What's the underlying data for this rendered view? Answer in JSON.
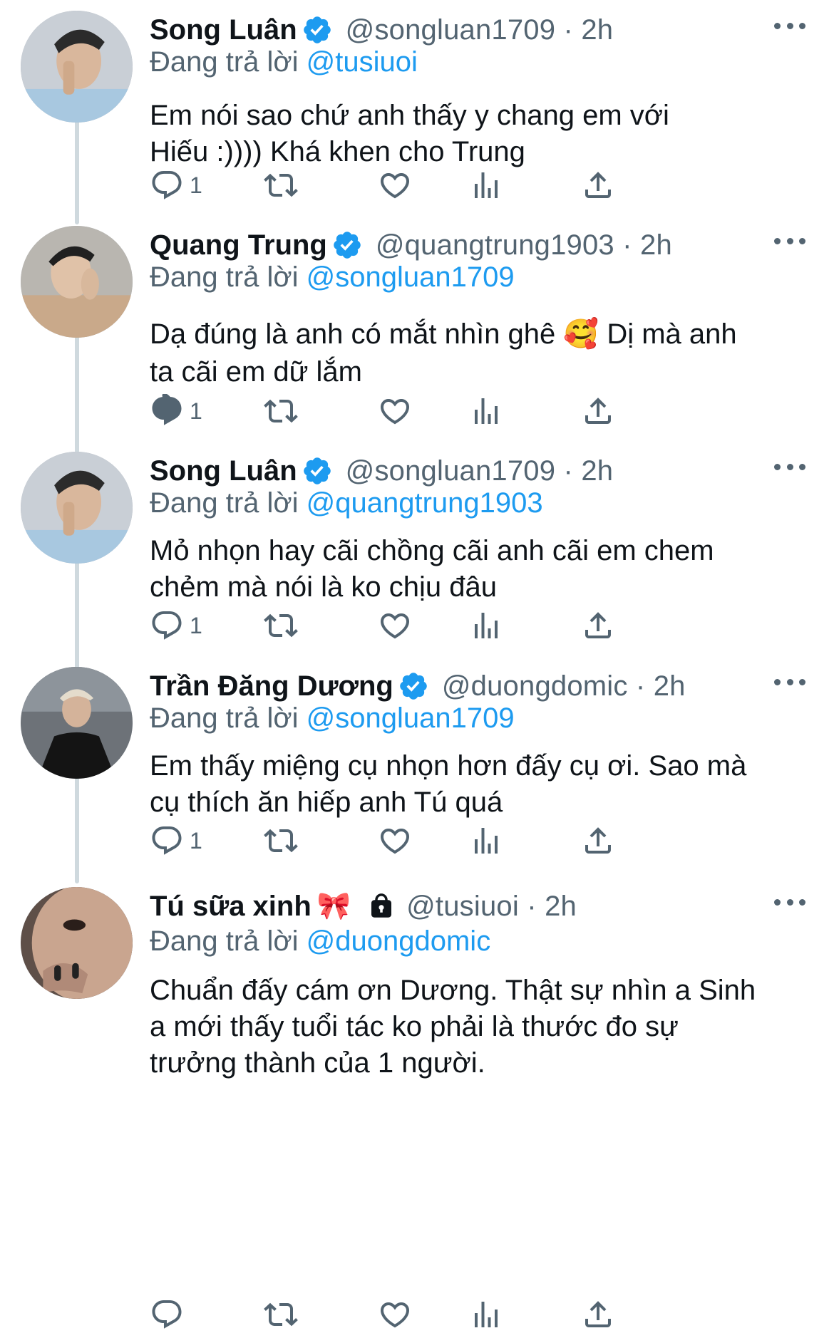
{
  "tweets": [
    {
      "name": "Song Luân",
      "verified": true,
      "handle": "@songluan1709",
      "time": "2h",
      "meta": "@songluan1709 · 2h",
      "reply_prefix": "Đang trả lời ",
      "reply_to": "@tusiuoi",
      "text": "Em nói sao chứ anh thấy y chang em với\nHiếu :)))) Khá khen cho Trung",
      "reply_count": "1"
    },
    {
      "name": "Quang Trung",
      "verified": true,
      "handle": "@quangtrung1903",
      "time": "2h",
      "meta": "@quangtrung1903 · 2h",
      "reply_prefix": "Đang trả lời ",
      "reply_to": "@songluan1709",
      "text": "Dạ đúng là anh có mắt nhìn ghê 🥰 Dị mà anh\nta cãi em dữ lắm",
      "reply_count": "1"
    },
    {
      "name": "Song Luân",
      "verified": true,
      "handle": "@songluan1709",
      "time": "2h",
      "meta": "@songluan1709 · 2h",
      "reply_prefix": "Đang trả lời ",
      "reply_to": "@quangtrung1903",
      "text": "Mỏ nhọn hay cãi chồng cãi anh cãi em chem\nchẻm mà nói là ko chịu đâu",
      "reply_count": "1"
    },
    {
      "name": "Trần Đăng Dương",
      "verified": true,
      "handle": "@duongdomic",
      "time": "2h",
      "meta": "@duongdomic · 2h",
      "reply_prefix": "Đang trả lời ",
      "reply_to": "@songluan1709",
      "text": "Em thấy miệng cụ nhọn hơn đấy cụ ơi. Sao mà\ncụ thích ăn hiếp anh Tú quá",
      "reply_count": "1"
    },
    {
      "name": "Tú sữa xinh",
      "name_emoji": "🎀",
      "verified": false,
      "protected": true,
      "handle": "@tusiuoi",
      "time": "2h",
      "meta": "@tusiuoi · 2h",
      "reply_prefix": "Đang trả lời ",
      "reply_to": "@duongdomic",
      "text": "Chuẩn đấy cám ơn Dương. Thật sự nhìn a Sinh\na mới thấy tuổi tác ko phải là thước đo sự\ntrưởng thành của 1 người.",
      "reply_count": ""
    }
  ],
  "icons": {
    "reply": "speech-bubble-icon",
    "retweet": "retweet-icon",
    "like": "heart-icon",
    "views": "bar-chart-icon",
    "share": "share-upload-icon",
    "more": "more-dots-icon",
    "verified": "verified-badge-icon",
    "protected": "lock-icon"
  },
  "colors": {
    "link": "#1d9bf0",
    "secondary": "#536471",
    "text": "#0f1419",
    "thread_line": "#cfd9de"
  }
}
